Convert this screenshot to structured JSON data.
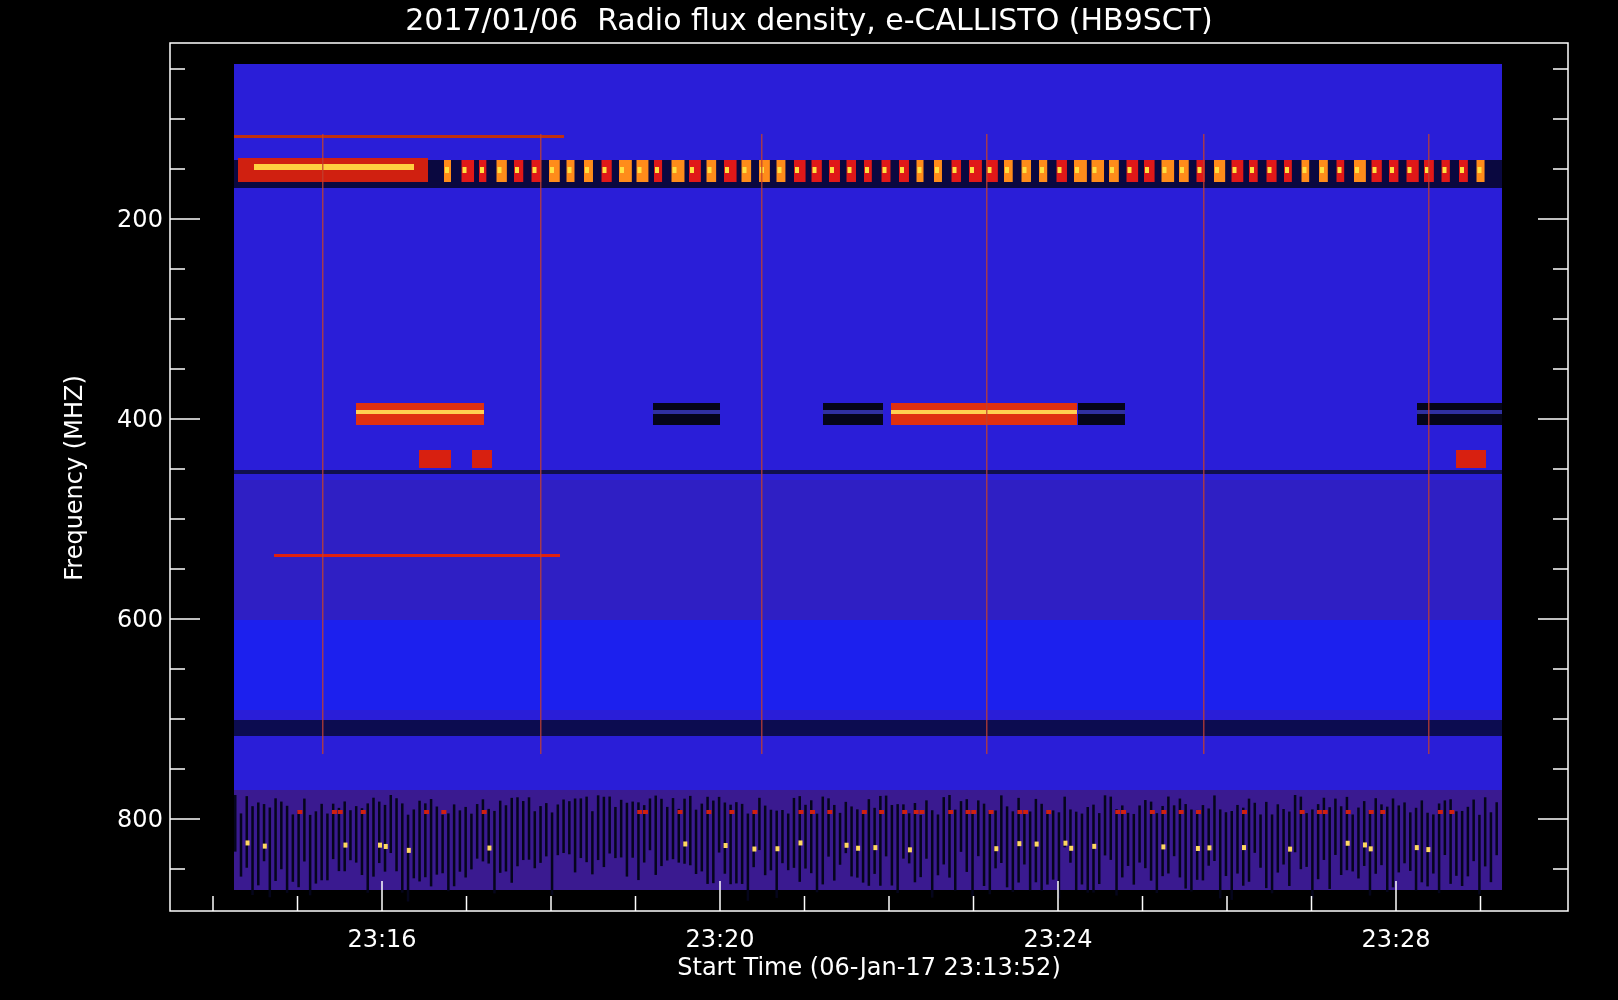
{
  "title": "2017/01/06  Radio flux density, e-CALLISTO (HB9SCT)",
  "y_axis": {
    "label": "Frequency (MHZ)",
    "ticks": [
      "200",
      "400",
      "600",
      "800"
    ]
  },
  "x_axis": {
    "label": "Start Time (06-Jan-17 23:13:52)",
    "ticks": [
      "23:16",
      "23:20",
      "23:24",
      "23:28"
    ]
  }
}
